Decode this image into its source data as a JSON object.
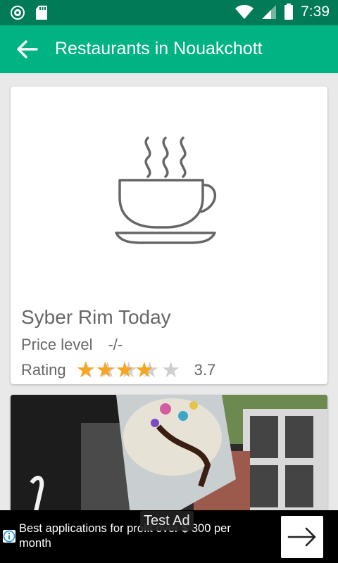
{
  "status_bar": {
    "time": "7:39",
    "icons": [
      "sync-icon",
      "sd-card-icon",
      "wifi-icon",
      "cell-signal-icon",
      "battery-icon"
    ]
  },
  "app_bar": {
    "title": "Restaurants in Nouakchott",
    "back_icon": "back-arrow-icon"
  },
  "restaurants": [
    {
      "name": "Syber Rim Today",
      "price_label": "Price level",
      "price_value": "-/-",
      "rating_label": "Rating",
      "rating": 3.7,
      "rating_text": "3.7",
      "rating_max": 5,
      "image_icon": "coffee-cup-icon"
    }
  ],
  "ad": {
    "text": "Best applications for profit over $ 300 per month",
    "tag": "Test Ad",
    "info_icon": "info-icon",
    "arrow_icon": "arrow-right-icon"
  },
  "colors": {
    "status_bar": "#007a57",
    "app_bar": "#00b383",
    "star_filled": "#f6a623",
    "star_empty": "#cfcfcf",
    "text_secondary": "#666666"
  }
}
